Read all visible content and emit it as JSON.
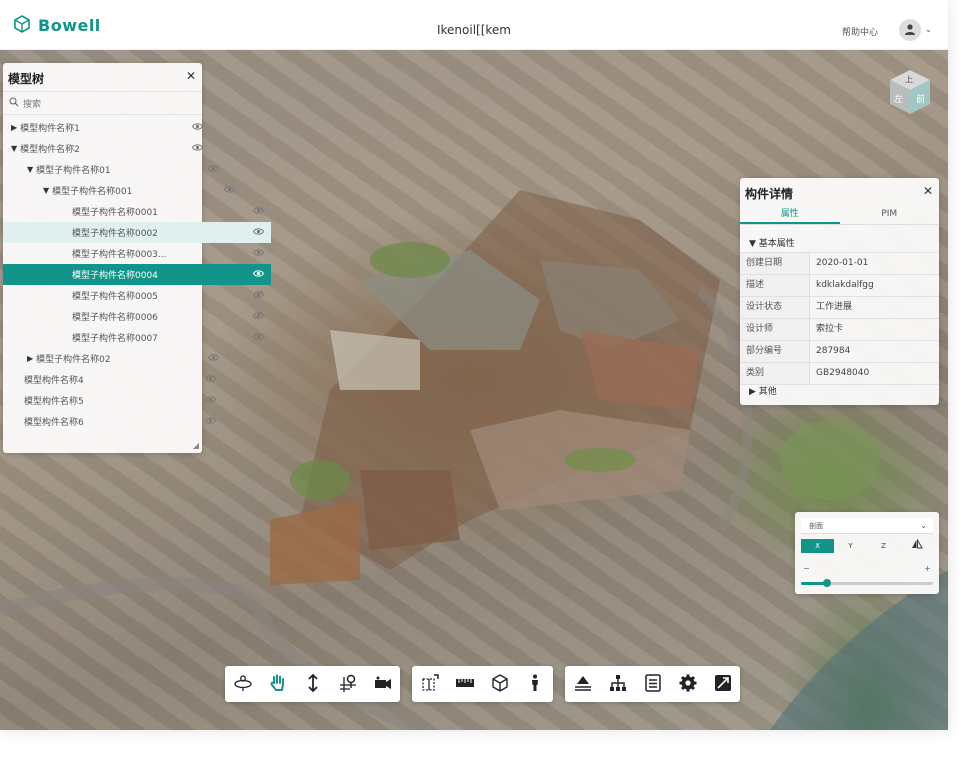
{
  "app": {
    "brand": "Bowell",
    "title": "Ikenoil[[kem",
    "help_label": "帮助中心"
  },
  "colors": {
    "accent": "#11958a"
  },
  "model_tree": {
    "title": "模型树",
    "search_placeholder": "搜索",
    "items": [
      {
        "label": "模型构件名称1",
        "expander": "▶",
        "eye": "eye-icon"
      },
      {
        "label": "模型构件名称2",
        "expander": "▼",
        "eye": "eye-icon"
      },
      {
        "label": "模型子构件名称01",
        "expander": "▼",
        "eye": "eye-icon"
      },
      {
        "label": "模型子构件名称001",
        "expander": "▼",
        "eye": "eye-icon"
      },
      {
        "label": "模型子构件名称0001",
        "expander": "",
        "eye": "eye-icon"
      },
      {
        "label": "模型子构件名称0002",
        "expander": "",
        "eye": "eye-icon",
        "state": "hover"
      },
      {
        "label": "模型子构件名称0003...",
        "expander": "",
        "eye": "eye-icon"
      },
      {
        "label": "模型子构件名称0004",
        "expander": "",
        "eye": "eye-icon",
        "state": "selected"
      },
      {
        "label": "模型子构件名称0005",
        "expander": "",
        "eye": "eye-off-icon"
      },
      {
        "label": "模型子构件名称0006",
        "expander": "",
        "eye": "eye-off-icon"
      },
      {
        "label": "模型子构件名称0007",
        "expander": "",
        "eye": "eye-icon"
      },
      {
        "label": "模型子构件名称02",
        "expander": "▶",
        "eye": "eye-icon"
      },
      {
        "label": "模型构件名称4",
        "expander": "",
        "eye": "eye-icon"
      },
      {
        "label": "模型构件名称5",
        "expander": "",
        "eye": "eye-icon"
      },
      {
        "label": "模型构件名称6",
        "expander": "",
        "eye": "eye-icon"
      }
    ]
  },
  "view_cube": {
    "faces": [
      "左",
      "前",
      "上"
    ]
  },
  "component_detail": {
    "title": "构件详情",
    "tabs": [
      {
        "label": "属性",
        "active": true
      },
      {
        "label": "PIM",
        "active": false
      }
    ],
    "basic_section": "基本属性",
    "other_section": "其他",
    "properties": [
      {
        "key": "创建日期",
        "value": "2020-01-01"
      },
      {
        "key": "描述",
        "value": "kdklakdalfgg"
      },
      {
        "key": "设计状态",
        "value": "工作进展"
      },
      {
        "key": "设计师",
        "value": "索拉卡"
      },
      {
        "key": "部分编号",
        "value": "287984"
      },
      {
        "key": "类别",
        "value": "GB2948040"
      }
    ]
  },
  "section_panel": {
    "dropdown_value": "剖面",
    "axes": [
      {
        "label": "X",
        "active": true
      },
      {
        "label": "Y",
        "active": false
      },
      {
        "label": "Z",
        "active": false
      }
    ],
    "minus": "−",
    "plus": "+",
    "slider_fraction": 0.2
  },
  "toolbar": {
    "groups": [
      [
        "orbit-icon",
        "pan-hand-icon",
        "vertical-move-icon",
        "pin-plane-icon",
        "camera-icon"
      ],
      [
        "section-box-icon",
        "ruler-icon",
        "cube-icon",
        "person-icon"
      ],
      [
        "layers-icon",
        "hierarchy-icon",
        "list-icon",
        "settings-icon",
        "fullscreen-icon"
      ]
    ]
  }
}
